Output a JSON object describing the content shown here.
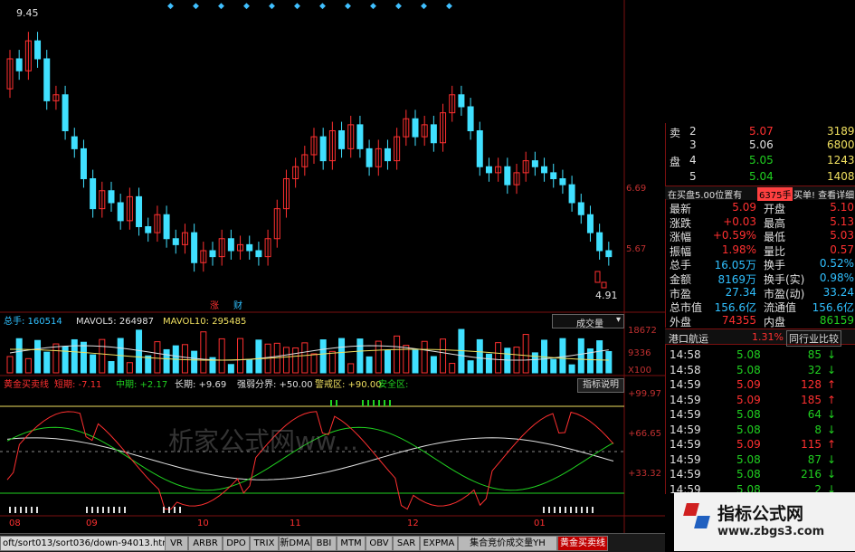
{
  "colors": {
    "up": "#ff3030",
    "down": "#40e0ff",
    "axis": "#c03030",
    "grid": "#7a1010",
    "bull": "#20d020",
    "accent": "#f0e060"
  },
  "price_panel": {
    "high_mark": "9.45",
    "low_mark": "4.91",
    "axis_ticks": [
      "6.69",
      "5.67"
    ],
    "markers": [
      "涨",
      "财"
    ]
  },
  "volume_panel": {
    "total_label": "总手: 160514",
    "mavol5": "MAVOL5: 264987",
    "mavol10": "MAVOL10: 295485",
    "indicator_select": "成交量",
    "axis_ticks": [
      "18672",
      "9336",
      "X100"
    ]
  },
  "indicator_panel": {
    "name": "黄金买卖线",
    "short": "短期: -7.11",
    "mid": "中期: +2.17",
    "long": "长期: +9.69",
    "strong_weak": "强弱分界: +50.00",
    "warning": "警戒区: +90.00",
    "safe": "安全区:",
    "help_button": "指标说明",
    "axis_ticks": [
      "+99.97",
      "+66.65",
      "+33.32"
    ],
    "watermark": "析家公式网ww...",
    "date_ticks": [
      "08",
      "09",
      "10",
      "11",
      "12",
      "01"
    ]
  },
  "order_book": {
    "rows": [
      {
        "label": "卖",
        "level": "2",
        "price": "5.07",
        "vol": "3189"
      },
      {
        "label": "",
        "level": "3",
        "price": "5.06",
        "vol": "6800"
      },
      {
        "label": "盘",
        "level": "4",
        "price": "5.05",
        "vol": "1243"
      },
      {
        "label": "",
        "level": "5",
        "price": "5.04",
        "vol": "1408"
      }
    ],
    "notice": "在买盘5.00位置有",
    "notice_vol": "6375手",
    "notice_link": "买单! 查看详细"
  },
  "quote": {
    "rows": [
      {
        "k1": "最新",
        "v1": "5.09",
        "k2": "开盘",
        "v2": "5.10"
      },
      {
        "k1": "涨跌",
        "v1": "+0.03",
        "k2": "最高",
        "v2": "5.13"
      },
      {
        "k1": "涨幅",
        "v1": "+0.59%",
        "k2": "最低",
        "v2": "5.03"
      },
      {
        "k1": "振幅",
        "v1": "1.98%",
        "k2": "量比",
        "v2": "0.57"
      },
      {
        "k1": "总手",
        "v1": "16.05万",
        "k2": "换手",
        "v2": "0.52%"
      },
      {
        "k1": "金额",
        "v1": "8169万",
        "k2": "换手(实)",
        "v2": "0.98%"
      },
      {
        "k1": "市盈",
        "v1": "27.34",
        "k2": "市盈(动)",
        "v2": "33.24"
      },
      {
        "k1": "总市值",
        "v1": "156.6亿",
        "k2": "流通值",
        "v2": "156.6亿"
      },
      {
        "k1": "外盘",
        "v1": "74355",
        "k2": "内盘",
        "v2": "86159"
      }
    ]
  },
  "sector": {
    "name": "港口航运",
    "change": "1.31%",
    "compare": "同行业比较"
  },
  "ticks": [
    {
      "t": "14:58",
      "p": "5.08",
      "v": "85",
      "d": "down"
    },
    {
      "t": "14:58",
      "p": "5.08",
      "v": "32",
      "d": "down"
    },
    {
      "t": "14:59",
      "p": "5.09",
      "v": "128",
      "d": "up"
    },
    {
      "t": "14:59",
      "p": "5.09",
      "v": "185",
      "d": "up"
    },
    {
      "t": "14:59",
      "p": "5.08",
      "v": "64",
      "d": "down"
    },
    {
      "t": "14:59",
      "p": "5.08",
      "v": "8",
      "d": "down"
    },
    {
      "t": "14:59",
      "p": "5.09",
      "v": "115",
      "d": "up"
    },
    {
      "t": "14:59",
      "p": "5.08",
      "v": "87",
      "d": "down"
    },
    {
      "t": "14:59",
      "p": "5.08",
      "v": "216",
      "d": "down"
    },
    {
      "t": "14:59",
      "p": "5.08",
      "v": "2",
      "d": "down"
    }
  ],
  "tabs": [
    "oft/sort013/sort036/down-94013.html",
    "VR",
    "ARBR",
    "DPO",
    "TRIX",
    "新DMA",
    "BBI",
    "MTM",
    "OBV",
    "SAR",
    "EXPMA",
    "集合竞价成交量YH",
    "黄金买卖线"
  ],
  "logo": {
    "title": "指标公式网",
    "url": "www.zbgs3.com"
  },
  "candles": [
    [
      8.3,
      8.8
    ],
    [
      8.8,
      8.6
    ],
    [
      8.6,
      9.1
    ],
    [
      9.1,
      8.8
    ],
    [
      8.8,
      8.1
    ],
    [
      8.1,
      8.2
    ],
    [
      8.2,
      7.6
    ],
    [
      7.5,
      7.3
    ],
    [
      7.3,
      6.8
    ],
    [
      6.8,
      6.3
    ],
    [
      6.3,
      6.6
    ],
    [
      6.6,
      6.4
    ],
    [
      6.4,
      6.1
    ],
    [
      6.1,
      6.5
    ],
    [
      6.5,
      6.0
    ],
    [
      6.0,
      5.9
    ],
    [
      5.9,
      6.2
    ],
    [
      6.2,
      5.8
    ],
    [
      5.8,
      5.7
    ],
    [
      5.7,
      5.9
    ],
    [
      5.9,
      5.4
    ],
    [
      5.4,
      5.6
    ],
    [
      5.6,
      5.5
    ],
    [
      5.5,
      5.8
    ],
    [
      5.8,
      5.6
    ],
    [
      5.6,
      5.7
    ],
    [
      5.7,
      5.6
    ],
    [
      5.6,
      5.5
    ],
    [
      5.5,
      5.8
    ],
    [
      5.8,
      6.3
    ],
    [
      6.3,
      6.8
    ],
    [
      6.8,
      7.0
    ],
    [
      7.0,
      7.2
    ],
    [
      7.2,
      7.5
    ],
    [
      7.5,
      7.1
    ],
    [
      7.1,
      7.6
    ],
    [
      7.6,
      7.3
    ],
    [
      7.3,
      7.7
    ],
    [
      7.7,
      7.3
    ],
    [
      7.3,
      7.0
    ],
    [
      7.0,
      7.3
    ],
    [
      7.3,
      7.1
    ],
    [
      7.1,
      7.5
    ],
    [
      7.5,
      7.8
    ],
    [
      7.8,
      7.5
    ],
    [
      7.5,
      7.7
    ],
    [
      7.7,
      7.4
    ],
    [
      7.4,
      7.9
    ],
    [
      7.9,
      8.2
    ],
    [
      8.2,
      8.0
    ],
    [
      8.0,
      7.6
    ],
    [
      7.6,
      7.0
    ],
    [
      7.0,
      6.9
    ],
    [
      6.9,
      7.0
    ],
    [
      7.0,
      6.7
    ],
    [
      6.7,
      6.9
    ],
    [
      6.9,
      7.1
    ],
    [
      7.1,
      7.0
    ],
    [
      7.0,
      6.9
    ],
    [
      6.9,
      6.8
    ],
    [
      6.8,
      6.7
    ],
    [
      6.7,
      6.4
    ],
    [
      6.4,
      6.2
    ],
    [
      6.2,
      5.9
    ],
    [
      5.9,
      5.6
    ],
    [
      5.6,
      5.5
    ]
  ]
}
